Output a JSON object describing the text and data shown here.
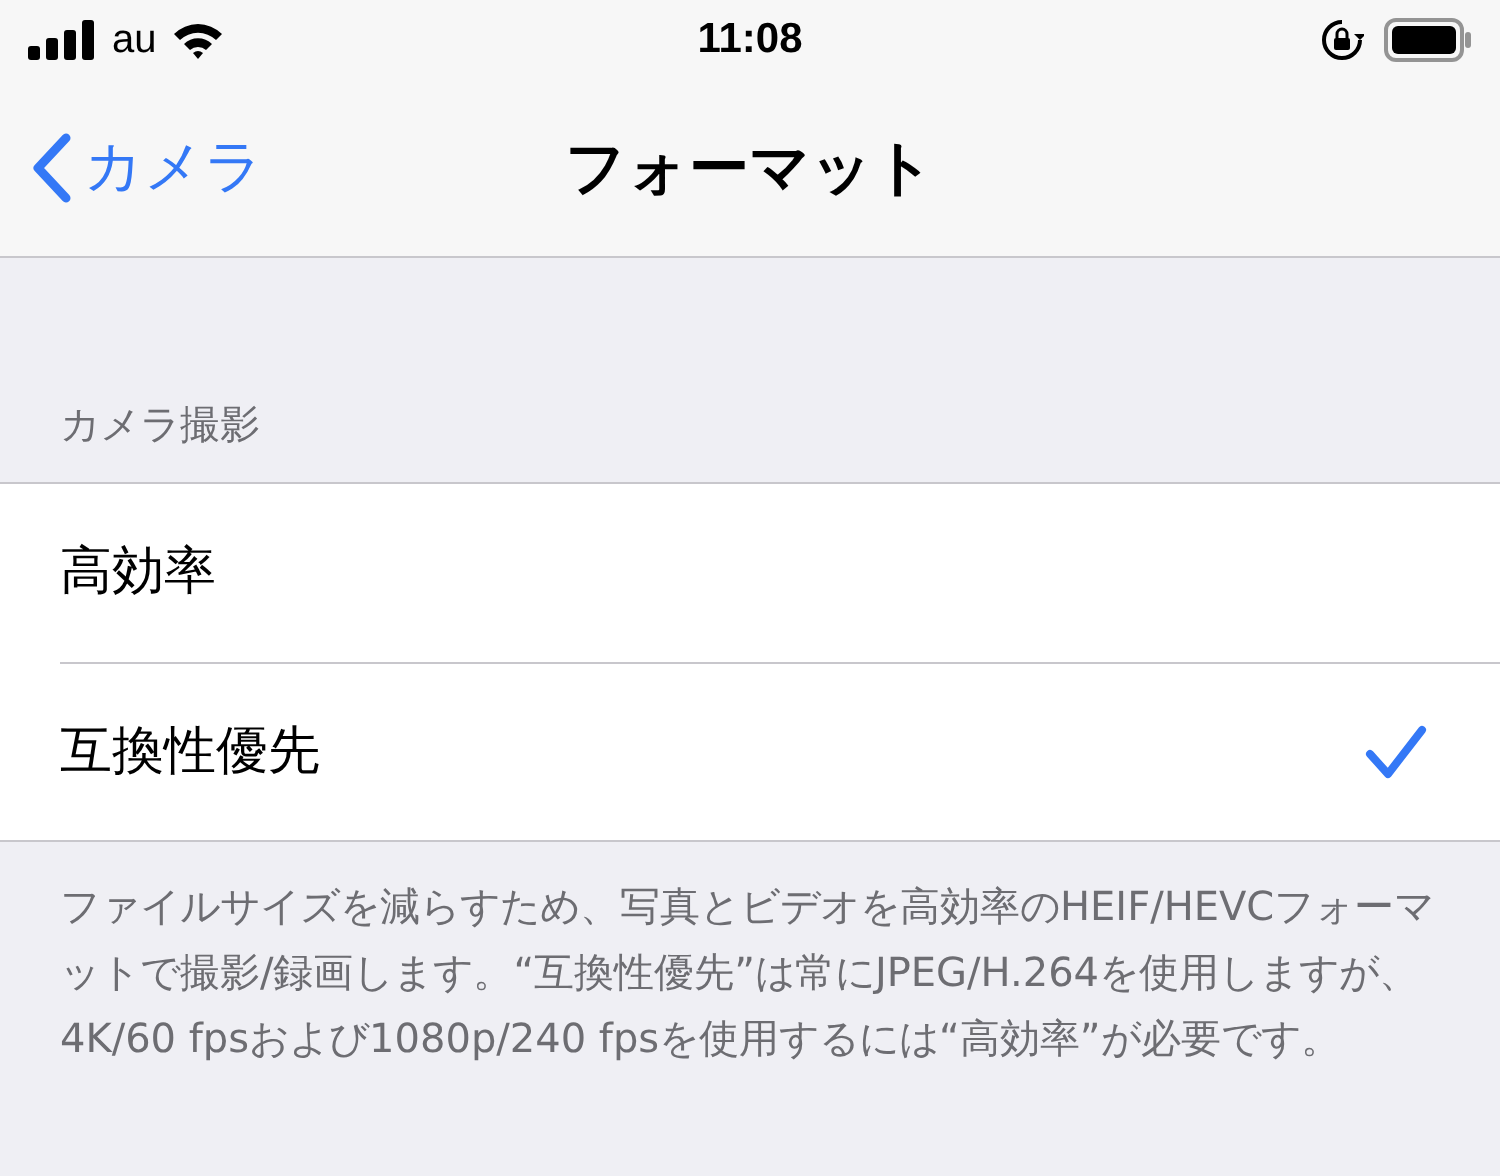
{
  "status_bar": {
    "carrier": "au",
    "time": "11:08"
  },
  "nav": {
    "back": "カメラ",
    "title": "フォーマット"
  },
  "section": {
    "header": "カメラ撮影",
    "options": [
      {
        "label": "高効率",
        "selected": false
      },
      {
        "label": "互換性優先",
        "selected": true
      }
    ],
    "footer": "ファイルサイズを減らすため、写真とビデオを高効率のHEIF/HEVCフォーマットで撮影/録画します。“互換性優先”は常にJPEG/H.264を使用しますが、4K/60 fpsおよび1080p/240 fpsを使用するには“高効率”が必要です。"
  }
}
